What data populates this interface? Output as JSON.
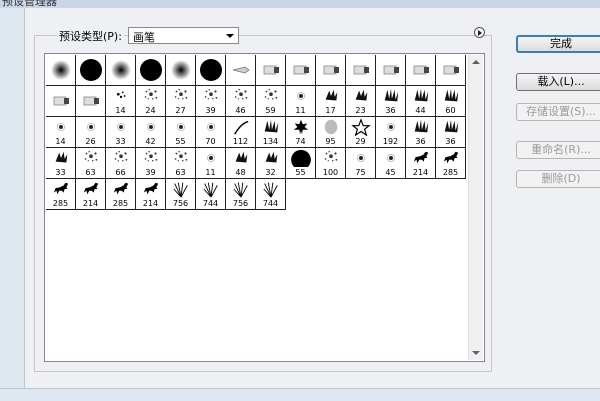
{
  "window": {
    "title": "预设管理器"
  },
  "preset_type": {
    "label": "预设类型(P):",
    "value": "画笔"
  },
  "buttons": {
    "done": "完成",
    "load": "载入(L)...",
    "save": "存储设置(S)...",
    "rename": "重命名(R)...",
    "delete": "删除(D)"
  },
  "brushes": [
    {
      "kind": "soft",
      "size": ""
    },
    {
      "kind": "hard",
      "size": ""
    },
    {
      "kind": "soft",
      "size": ""
    },
    {
      "kind": "hard",
      "size": ""
    },
    {
      "kind": "soft",
      "size": ""
    },
    {
      "kind": "hard",
      "size": ""
    },
    {
      "kind": "pen",
      "size": ""
    },
    {
      "kind": "marker",
      "size": ""
    },
    {
      "kind": "marker",
      "size": ""
    },
    {
      "kind": "marker",
      "size": ""
    },
    {
      "kind": "marker",
      "size": ""
    },
    {
      "kind": "marker",
      "size": ""
    },
    {
      "kind": "marker",
      "size": ""
    },
    {
      "kind": "marker",
      "size": ""
    },
    {
      "kind": "marker",
      "size": ""
    },
    {
      "kind": "marker",
      "size": ""
    },
    {
      "kind": "scatter",
      "size": "14"
    },
    {
      "kind": "splatter",
      "size": "24"
    },
    {
      "kind": "splatter",
      "size": "27"
    },
    {
      "kind": "splatter",
      "size": "39"
    },
    {
      "kind": "splatter",
      "size": "46"
    },
    {
      "kind": "splatter",
      "size": "59"
    },
    {
      "kind": "dot",
      "size": "11"
    },
    {
      "kind": "leaves",
      "size": "17"
    },
    {
      "kind": "leaves",
      "size": "23"
    },
    {
      "kind": "grass",
      "size": "36"
    },
    {
      "kind": "grass",
      "size": "44"
    },
    {
      "kind": "grass",
      "size": "60"
    },
    {
      "kind": "dot",
      "size": "14"
    },
    {
      "kind": "dot",
      "size": "26"
    },
    {
      "kind": "dot",
      "size": "33"
    },
    {
      "kind": "dot",
      "size": "42"
    },
    {
      "kind": "dot",
      "size": "55"
    },
    {
      "kind": "dot",
      "size": "70"
    },
    {
      "kind": "stroke",
      "size": "112"
    },
    {
      "kind": "grass",
      "size": "134"
    },
    {
      "kind": "maple",
      "size": "74"
    },
    {
      "kind": "leaf",
      "size": "95"
    },
    {
      "kind": "star",
      "size": "29"
    },
    {
      "kind": "dot",
      "size": "192"
    },
    {
      "kind": "grass",
      "size": "36"
    },
    {
      "kind": "grass",
      "size": "36"
    },
    {
      "kind": "leaves",
      "size": "33"
    },
    {
      "kind": "splatter",
      "size": "63"
    },
    {
      "kind": "splatter",
      "size": "66"
    },
    {
      "kind": "splatter",
      "size": "39"
    },
    {
      "kind": "splatter",
      "size": "63"
    },
    {
      "kind": "dot",
      "size": "11"
    },
    {
      "kind": "leaves",
      "size": "48"
    },
    {
      "kind": "leaves",
      "size": "32"
    },
    {
      "kind": "hard",
      "size": "55"
    },
    {
      "kind": "splatter",
      "size": "100"
    },
    {
      "kind": "dot",
      "size": "75"
    },
    {
      "kind": "dot",
      "size": "45"
    },
    {
      "kind": "horse",
      "size": "214"
    },
    {
      "kind": "horse",
      "size": "285"
    },
    {
      "kind": "horse",
      "size": "285"
    },
    {
      "kind": "horse",
      "size": "214"
    },
    {
      "kind": "horse",
      "size": "285"
    },
    {
      "kind": "horse",
      "size": "214"
    },
    {
      "kind": "fireworks",
      "size": "756"
    },
    {
      "kind": "fireworks",
      "size": "744"
    },
    {
      "kind": "fireworks",
      "size": "756"
    },
    {
      "kind": "fireworks",
      "size": "744"
    }
  ]
}
